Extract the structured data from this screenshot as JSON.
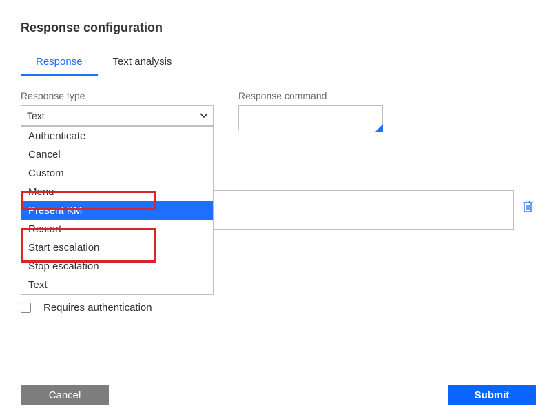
{
  "title": "Response configuration",
  "tabs": {
    "response": "Response",
    "analysis": "Text analysis"
  },
  "fields": {
    "response_type": {
      "label": "Response type",
      "selected": "Text",
      "options": [
        "Authenticate",
        "Cancel",
        "Custom",
        "Menu",
        "Present KM",
        "Restart",
        "Start escalation",
        "Stop escalation",
        "Text"
      ],
      "highlighted_index": 4
    },
    "response_command": {
      "label": "Response command",
      "value": ""
    },
    "main_text": {
      "value": ""
    },
    "requires_auth": {
      "label": "Requires authentication",
      "checked": false
    }
  },
  "buttons": {
    "cancel": "Cancel",
    "submit": "Submit"
  }
}
